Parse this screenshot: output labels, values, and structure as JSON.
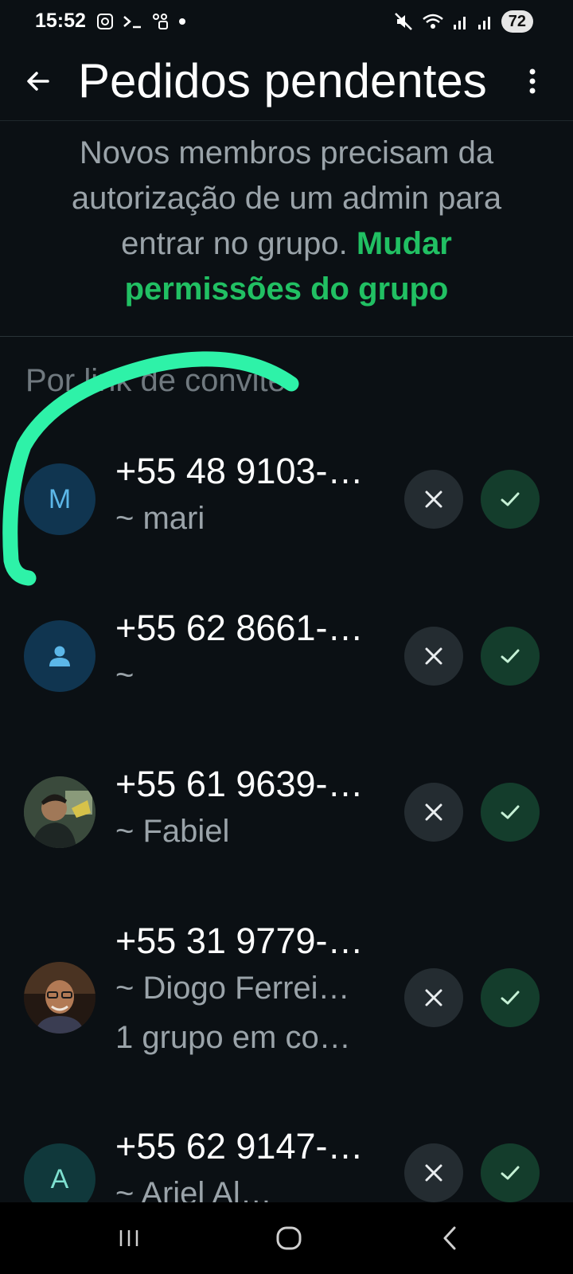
{
  "status_bar": {
    "time": "15:52",
    "battery": "72",
    "left_icons": [
      "screenshot-icon",
      "terminal-icon",
      "link-app-icon",
      "dot-icon"
    ],
    "right_icons": [
      "mute-icon",
      "wifi-icon",
      "signal-icon",
      "signal-icon"
    ]
  },
  "app_bar": {
    "title": "Pedidos pendentes",
    "back_icon": "arrow-left-icon",
    "menu_icon": "more-vertical-icon"
  },
  "info": {
    "text": "Novos membros precisam da autorização de um admin para entrar no grupo. ",
    "link": "Mudar permissões do grupo"
  },
  "section_label": "Por link de convite",
  "requests": [
    {
      "phone": "+55 48 9103-…",
      "sub": "~ mari",
      "avatar_letter": "M",
      "avatar_type": "letter",
      "avatar_style": "blue"
    },
    {
      "phone": "+55 62 8661-…",
      "sub": "~",
      "avatar_letter": "",
      "avatar_type": "person-icon",
      "avatar_style": "blue"
    },
    {
      "phone": "+55 61 9639-…",
      "sub": "~ Fabiel",
      "avatar_letter": "",
      "avatar_type": "photo",
      "avatar_style": "photo"
    },
    {
      "phone": "+55 31 9779-…",
      "sub": "~ Diogo Ferrei…",
      "sub2": "1 grupo em co…",
      "avatar_letter": "",
      "avatar_type": "photo",
      "avatar_style": "photo"
    },
    {
      "phone": "+55 62 9147-…",
      "sub": "~ Ariel Al…",
      "avatar_letter": "A",
      "avatar_type": "letter",
      "avatar_style": "teal"
    }
  ],
  "colors": {
    "background": "#0b1014",
    "accent_green": "#21c063",
    "annotation_stroke": "#2ef2a8"
  },
  "nav": {
    "recent_icon": "recent-apps-icon",
    "home_icon": "home-icon",
    "back_icon": "nav-back-icon"
  }
}
